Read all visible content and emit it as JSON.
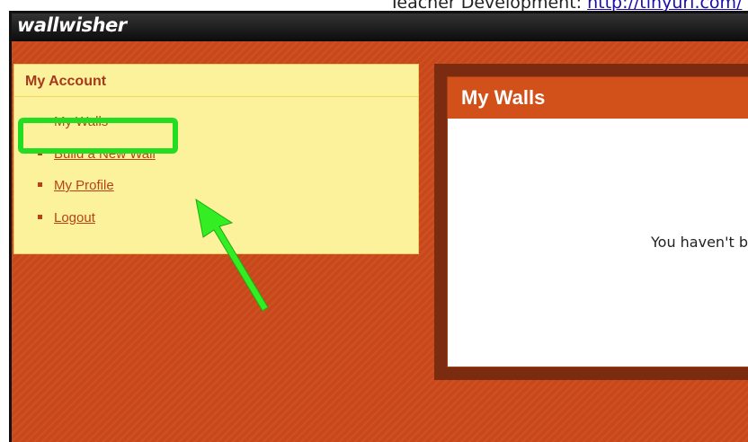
{
  "caption": {
    "text": "Teacher Development: ",
    "link": "http://tinyurl.com/"
  },
  "app": {
    "logo": "wallwisher"
  },
  "sidebar": {
    "title": "My Account",
    "items": [
      {
        "label": "My Walls"
      },
      {
        "label": "Build a New Wall"
      },
      {
        "label": "My Profile"
      },
      {
        "label": "Logout"
      }
    ]
  },
  "main": {
    "title": "My Walls",
    "message": "You haven't b"
  },
  "colors": {
    "background": "#c9481a",
    "sidebar_bg": "#fdf29c",
    "link": "#b84218",
    "highlight": "#22dd22",
    "panel_header": "#d2501a",
    "panel_border": "#7a2b10"
  }
}
